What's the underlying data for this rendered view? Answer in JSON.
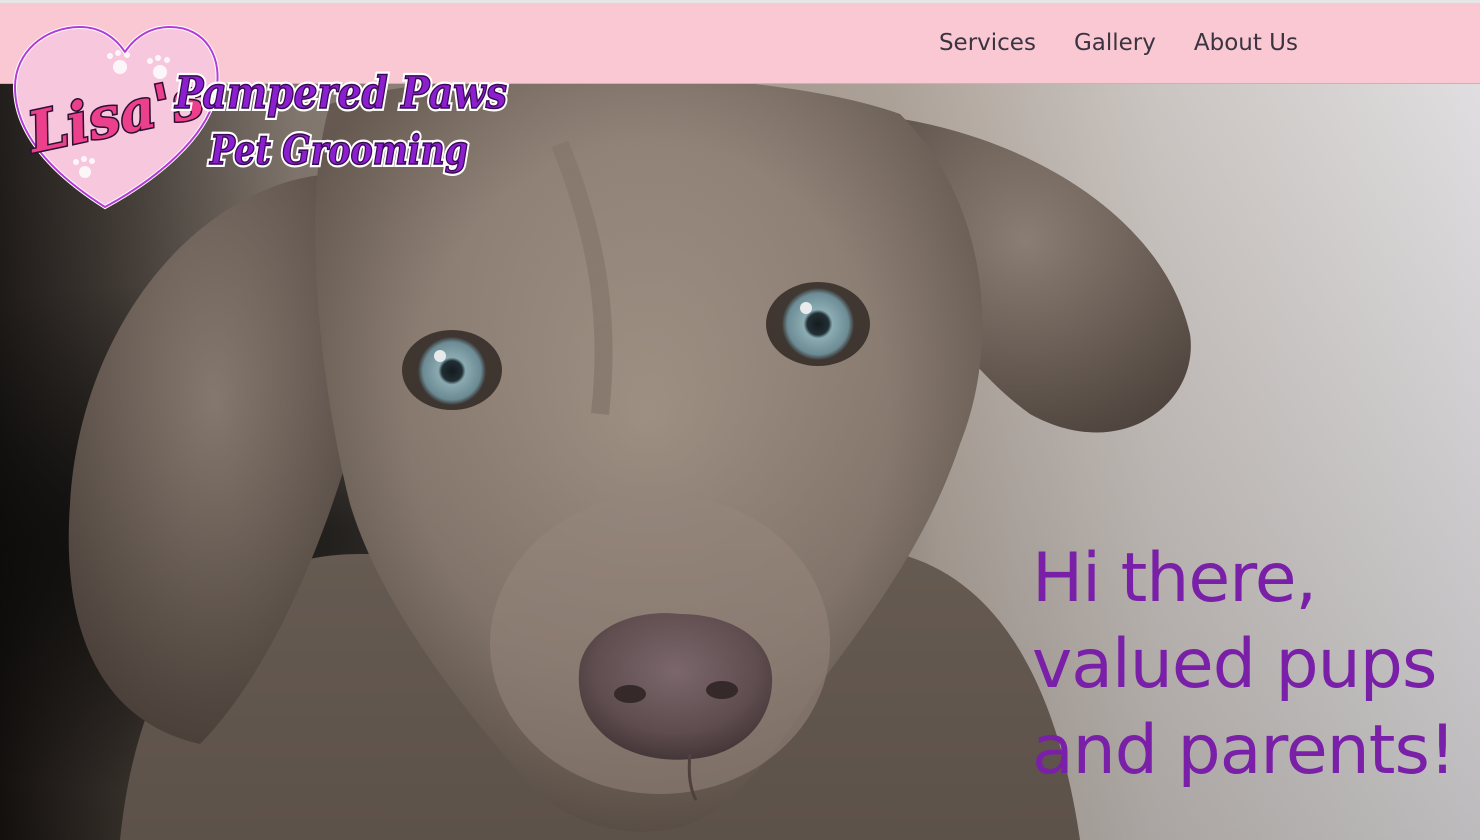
{
  "logo": {
    "script_text": "Lisa's",
    "line1": "Pampered Paws",
    "line2": "Pet Grooming"
  },
  "nav": {
    "items": [
      "Services",
      "Gallery",
      "About Us"
    ]
  },
  "hero": {
    "headline_line1": "Hi there,",
    "headline_line2": "valued pups",
    "headline_line3": "and parents!"
  },
  "colors": {
    "nav_bg": "#f9c8d2",
    "headline": "#7a1fa8",
    "logo_purple": "#8b1fd0",
    "logo_pink": "#ec3f8c"
  }
}
